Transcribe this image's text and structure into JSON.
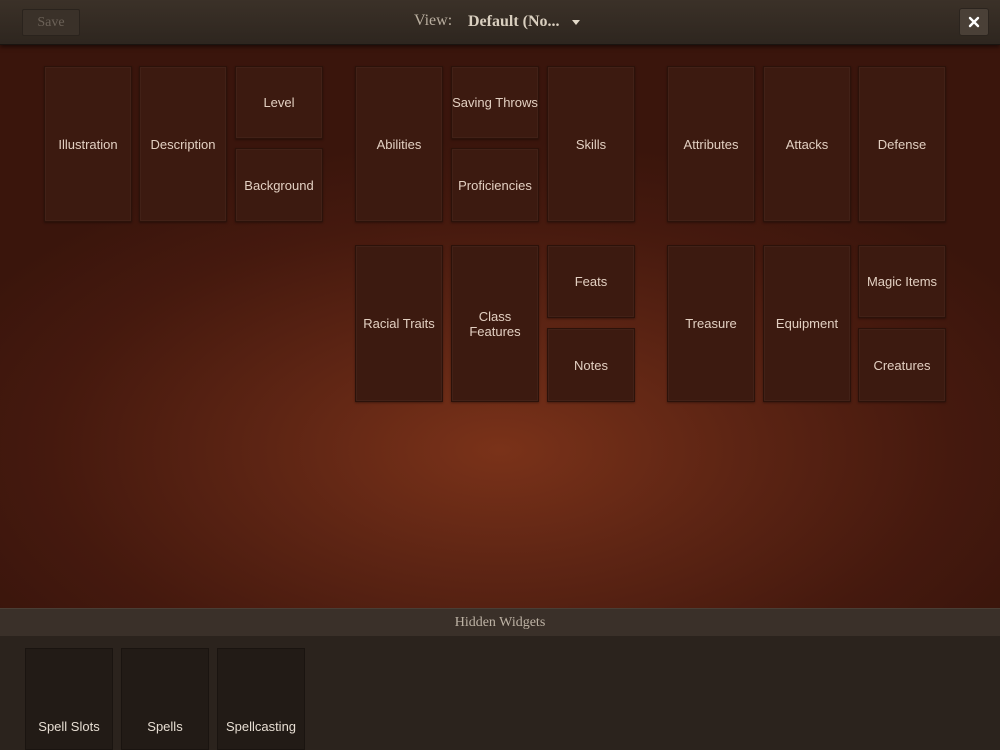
{
  "toolbar": {
    "save_label": "Save",
    "view_label": "View:",
    "view_value": "Default (No...",
    "close_icon": "close-icon"
  },
  "widgets": {
    "illustration": "Illustration",
    "description": "Description",
    "level": "Level",
    "background": "Background",
    "abilities": "Abilities",
    "saving_throws": "Saving Throws",
    "proficiencies": "Proficiencies",
    "skills": "Skills",
    "attributes": "Attributes",
    "attacks": "Attacks",
    "defense": "Defense",
    "racial_traits": "Racial Traits",
    "class_features": "Class Features",
    "feats": "Feats",
    "notes": "Notes",
    "treasure": "Treasure",
    "equipment": "Equipment",
    "magic_items": "Magic Items",
    "creatures": "Creatures"
  },
  "hidden": {
    "title": "Hidden Widgets",
    "items": [
      "Spell Slots",
      "Spells",
      "Spellcasting"
    ]
  },
  "colors": {
    "background_center": "#7a3219",
    "tile": "#3c1a10",
    "toolbar": "#3b3128"
  }
}
